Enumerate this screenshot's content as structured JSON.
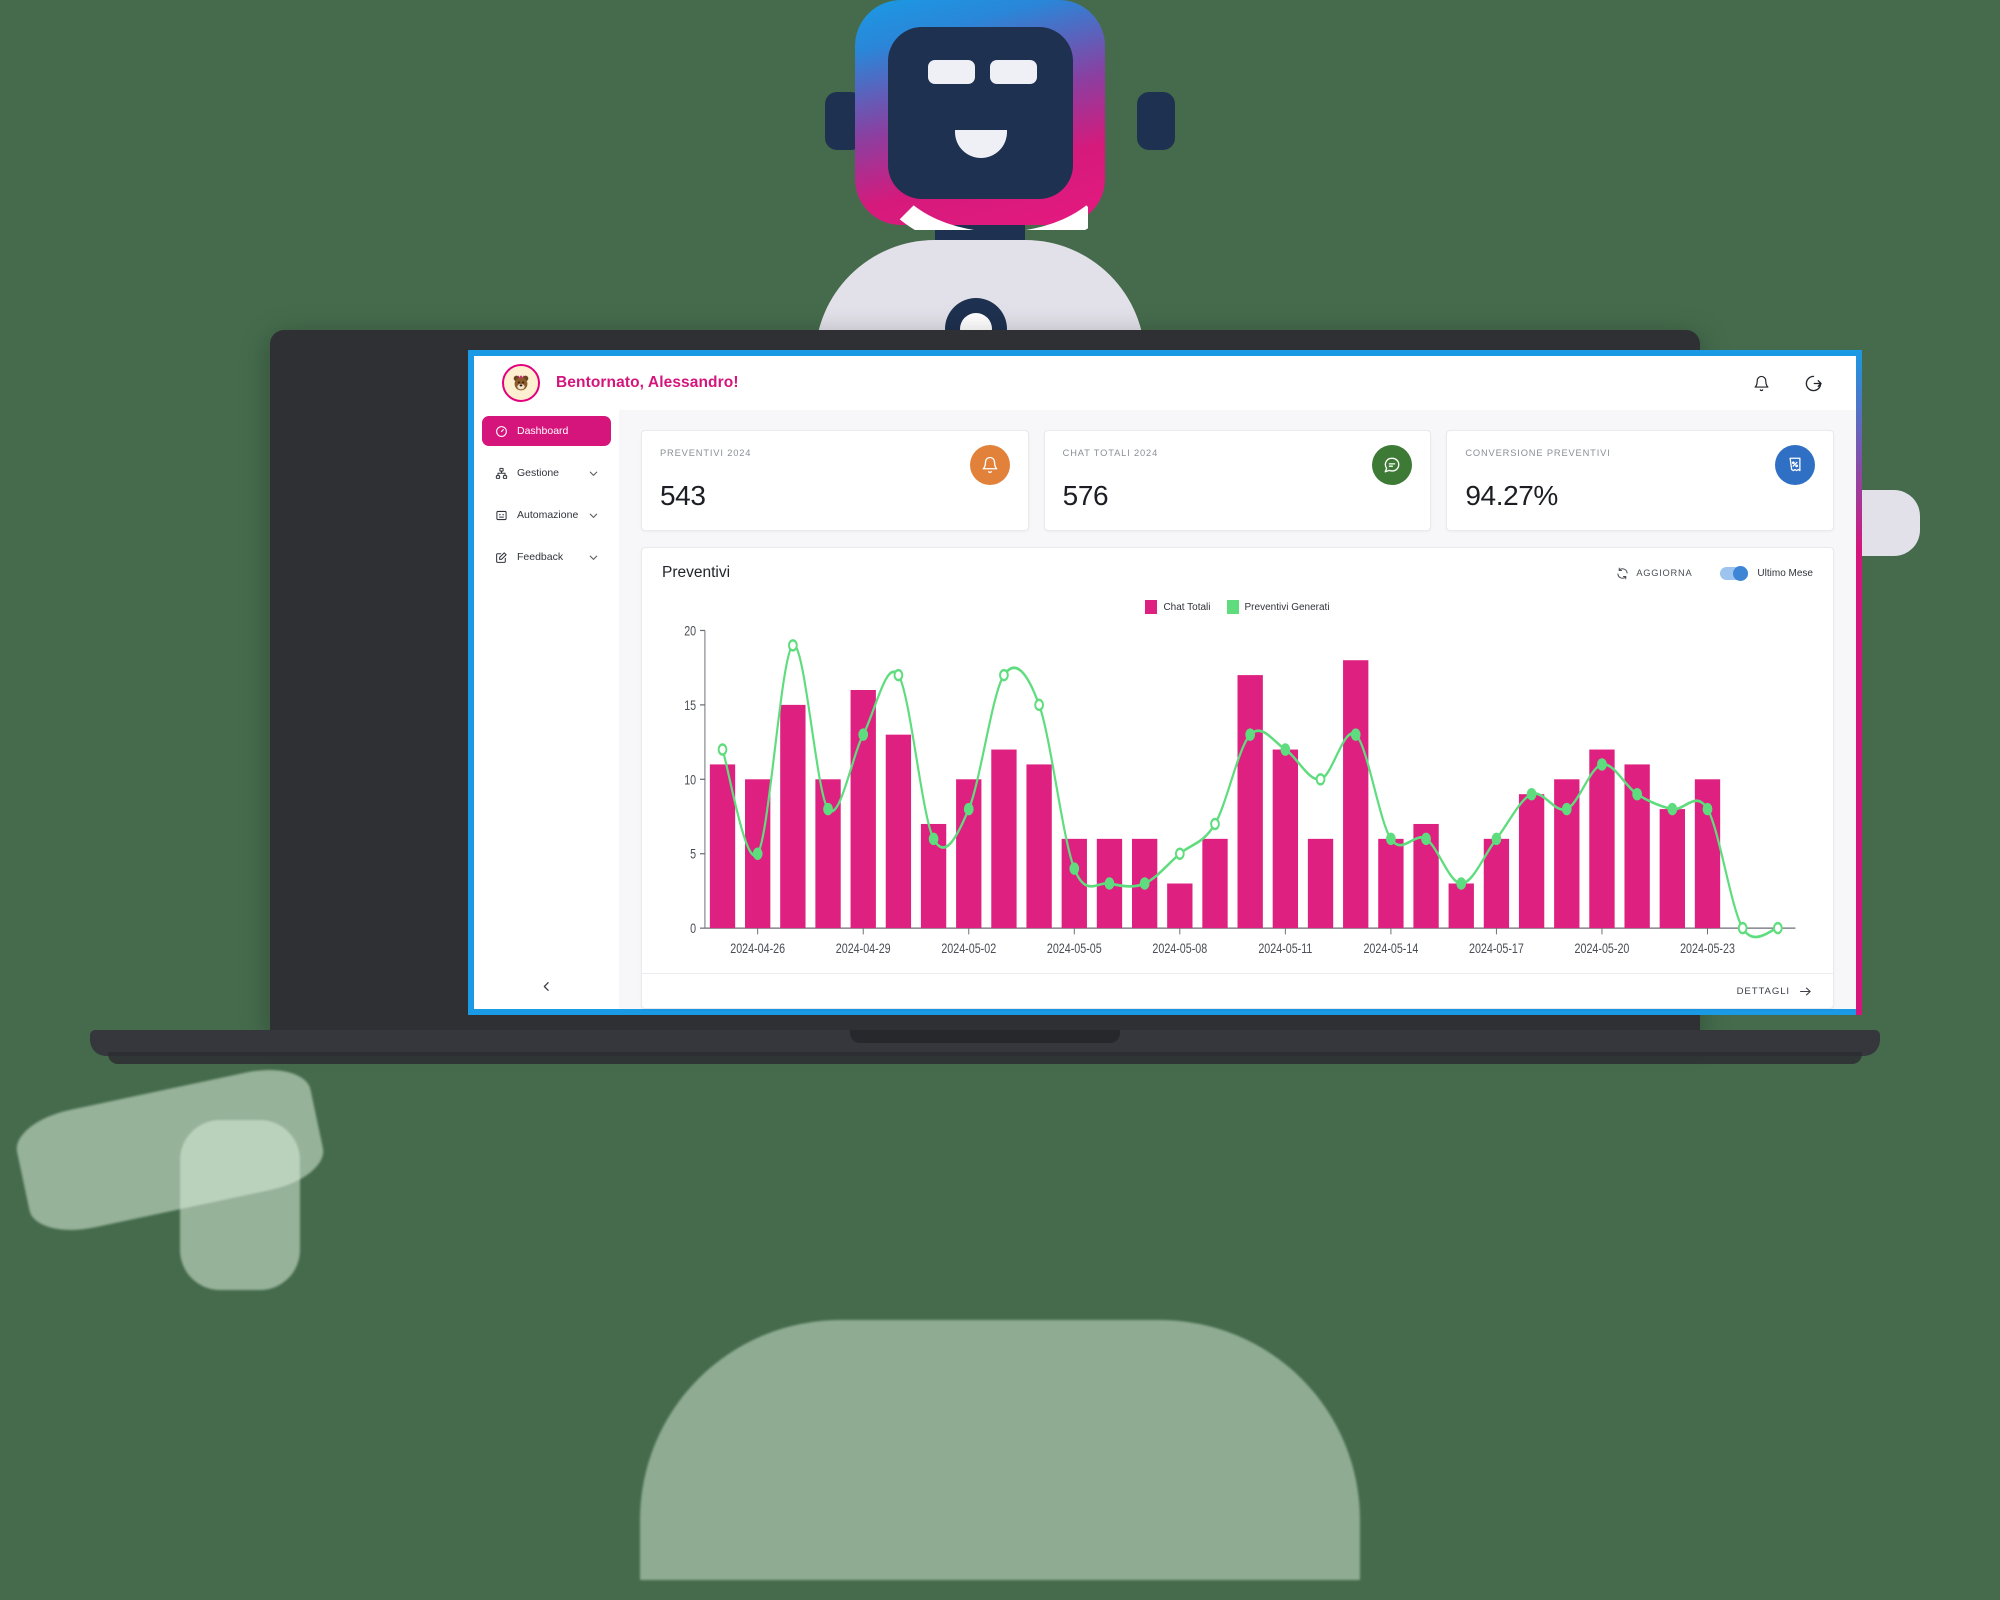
{
  "header": {
    "avatar_icon": "bear-avatar",
    "welcome": "Bentornato, Alessandro!",
    "notifications_icon": "bell-icon",
    "logout_icon": "logout-icon"
  },
  "sidebar": {
    "items": [
      {
        "label": "Dashboard",
        "icon": "speedometer-icon",
        "active": true,
        "chevron": false
      },
      {
        "label": "Gestione",
        "icon": "org-chart-icon",
        "active": false,
        "chevron": true
      },
      {
        "label": "Automazione",
        "icon": "robot-icon",
        "active": false,
        "chevron": true
      },
      {
        "label": "Feedback",
        "icon": "edit-square-icon",
        "active": false,
        "chevron": true
      }
    ],
    "collapse_icon": "chevron-left-icon"
  },
  "cards": [
    {
      "label": "PREVENTIVI 2024",
      "value": "543",
      "icon": "bell-icon",
      "color": "#e2813a"
    },
    {
      "label": "CHAT TOTALI 2024",
      "value": "576",
      "icon": "chat-icon",
      "color": "#3d7a36"
    },
    {
      "label": "CONVERSIONE PREVENTIVI",
      "value": "94.27%",
      "icon": "receipt-percent-icon",
      "color": "#2f6fc4"
    }
  ],
  "panel": {
    "title": "Preventivi",
    "refresh_label": "AGGIORNA",
    "refresh_icon": "refresh-icon",
    "toggle_label": "Ultimo Mese",
    "toggle_on": true,
    "details_label": "DETTAGLI",
    "details_icon": "arrow-right-icon"
  },
  "chart_data": {
    "type": "bar",
    "title": "Preventivi",
    "xlabel": "",
    "ylabel": "",
    "ylim": [
      0,
      20
    ],
    "yticks": [
      0,
      5,
      10,
      15,
      20
    ],
    "grid": false,
    "legend_position": "top-center",
    "x": [
      "2024-04-25",
      "2024-04-26",
      "2024-04-27",
      "2024-04-28",
      "2024-04-29",
      "2024-04-30",
      "2024-05-01",
      "2024-05-02",
      "2024-05-03",
      "2024-05-04",
      "2024-05-05",
      "2024-05-06",
      "2024-05-07",
      "2024-05-08",
      "2024-05-09",
      "2024-05-10",
      "2024-05-11",
      "2024-05-12",
      "2024-05-13",
      "2024-05-14",
      "2024-05-15",
      "2024-05-16",
      "2024-05-17",
      "2024-05-18",
      "2024-05-19",
      "2024-05-20",
      "2024-05-21",
      "2024-05-22",
      "2024-05-23",
      "2024-05-24",
      "2024-05-25"
    ],
    "tick_labels": [
      "2024-04-26",
      "2024-04-29",
      "2024-05-02",
      "2024-05-05",
      "2024-05-08",
      "2024-05-11",
      "2024-05-14",
      "2024-05-17",
      "2024-05-20",
      "2024-05-23"
    ],
    "tick_index": [
      1,
      4,
      7,
      10,
      13,
      16,
      19,
      22,
      25,
      28
    ],
    "series": [
      {
        "name": "Chat Totali",
        "type": "bar",
        "color": "#de2080",
        "values": [
          11,
          10,
          15,
          10,
          16,
          13,
          7,
          10,
          12,
          11,
          6,
          6,
          6,
          3,
          6,
          17,
          12,
          6,
          18,
          6,
          7,
          3,
          6,
          9,
          10,
          12,
          11,
          8,
          10,
          0,
          0
        ]
      },
      {
        "name": "Preventivi Generati",
        "type": "line",
        "color": "#5fdd7e",
        "values": [
          12,
          5,
          19,
          8,
          13,
          17,
          6,
          8,
          17,
          15,
          4,
          3,
          3,
          5,
          7,
          13,
          12,
          10,
          13,
          6,
          6,
          3,
          6,
          9,
          8,
          11,
          9,
          8,
          8,
          0,
          0
        ]
      }
    ]
  }
}
